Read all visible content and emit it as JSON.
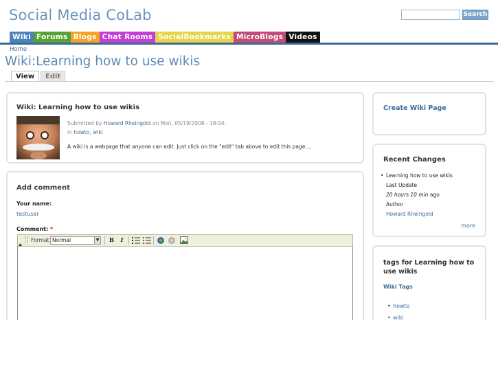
{
  "site": {
    "title": "Social Media CoLab",
    "search": {
      "placeholder": "",
      "button_label": "Search"
    }
  },
  "nav": {
    "items": [
      {
        "label": "Wiki",
        "color": "#4a83b9"
      },
      {
        "label": "Forums",
        "color": "#56a232"
      },
      {
        "label": "Blogs",
        "color": "#f5a324"
      },
      {
        "label": "Chat Rooms",
        "color": "#c33fd8"
      },
      {
        "label": "SocialBookmarks",
        "color": "#e6d44a"
      },
      {
        "label": "MicroBlogs",
        "color": "#c24b78"
      },
      {
        "label": "Videos",
        "color": "#111111"
      }
    ]
  },
  "breadcrumb": "Home",
  "page_title": "Wiki:Learning how to use wikis",
  "tabs": [
    {
      "label": "View",
      "active": true
    },
    {
      "label": "Edit",
      "active": false
    }
  ],
  "node": {
    "title": "Wiki: Learning how to use wikis",
    "submitted_prefix": "Submitted by",
    "author": "Howard Rheingold",
    "submitted_suffix": "on Mon, 05/19/2008 - 18:04.",
    "in_label": "in",
    "terms": [
      "howto",
      "wiki"
    ],
    "body_before": "A wiki is a webpage that",
    "body_em": "anyone",
    "body_after": "can edit. Just click on the \"edit\" tab above to edit this page...."
  },
  "comment_form": {
    "heading": "Add comment",
    "name_label": "Your name:",
    "name_value": "testuser",
    "comment_label": "Comment:",
    "required_mark": "*",
    "toolbar": {
      "format_label": "Format",
      "format_value": "Normal",
      "bold": "B",
      "italic": "I",
      "ordered_list_icon": "ordered-list-icon",
      "bullet_list_icon": "bullet-list-icon",
      "link_icon": "link-icon",
      "unlink_icon": "unlink-icon",
      "image_icon": "image-icon"
    }
  },
  "sidebar": {
    "create_link": "Create Wiki Page",
    "recent": {
      "heading": "Recent Changes",
      "item_title": "Learning how to use wikis",
      "last_update_label": "Last Update",
      "last_update_value": "20 hours 10 min",
      "ago": "ago",
      "author_label": "Author",
      "author_value": "Howard Rheingold",
      "more": "more"
    },
    "tags": {
      "heading": "tags for Learning how to use wikis",
      "sub": "Wiki Tags",
      "items": [
        "howto",
        "wiki"
      ]
    }
  }
}
